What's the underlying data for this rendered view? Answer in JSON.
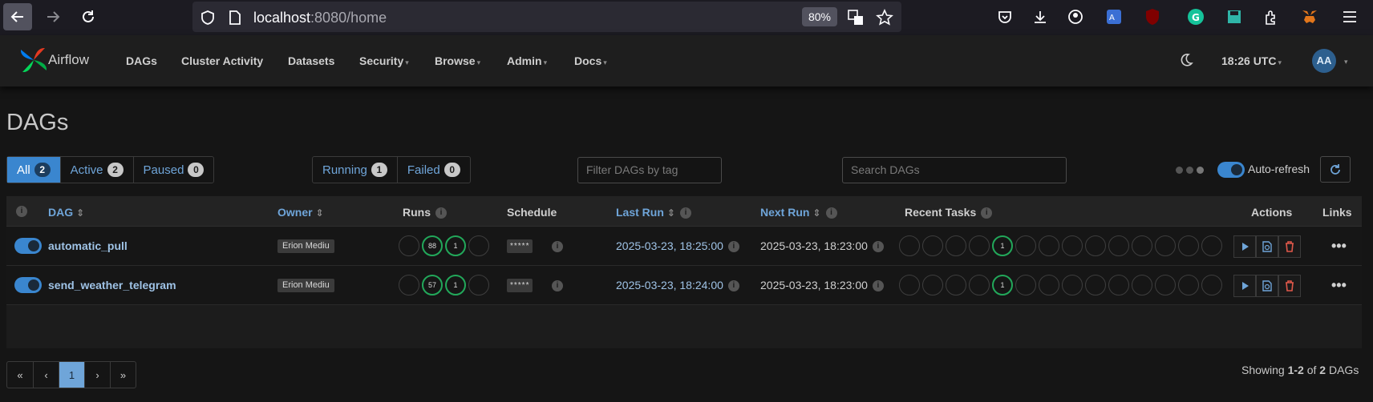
{
  "browser": {
    "url_host": "localhost",
    "url_rest": ":8080/home",
    "zoom": "80%"
  },
  "navbar": {
    "brand": "Airflow",
    "menu": [
      "DAGs",
      "Cluster Activity",
      "Datasets",
      "Security",
      "Browse",
      "Admin",
      "Docs"
    ],
    "time": "18:26 UTC",
    "user_initials": "AA"
  },
  "page": {
    "title": "DAGs",
    "status_filters": [
      {
        "label": "All",
        "count": "2"
      },
      {
        "label": "Active",
        "count": "2"
      },
      {
        "label": "Paused",
        "count": "0"
      }
    ],
    "run_filters": [
      {
        "label": "Running",
        "count": "1"
      },
      {
        "label": "Failed",
        "count": "0"
      }
    ],
    "tag_placeholder": "Filter DAGs by tag",
    "search_placeholder": "Search DAGs",
    "auto_refresh_label": "Auto-refresh"
  },
  "table": {
    "headers": {
      "dag": "DAG",
      "owner": "Owner",
      "runs": "Runs",
      "schedule": "Schedule",
      "last_run": "Last Run",
      "next_run": "Next Run",
      "recent_tasks": "Recent Tasks",
      "actions": "Actions",
      "links": "Links"
    },
    "rows": [
      {
        "name": "automatic_pull",
        "owner": "Erion Mediu",
        "runs": [
          "",
          "88",
          "1",
          ""
        ],
        "schedule": "*****",
        "last_run": "2025-03-23, 18:25:00",
        "next_run": "2025-03-23, 18:23:00",
        "recent_task_success": "1"
      },
      {
        "name": "send_weather_telegram",
        "owner": "Erion Mediu",
        "runs": [
          "",
          "57",
          "1",
          ""
        ],
        "schedule": "*****",
        "last_run": "2025-03-23, 18:24:00",
        "next_run": "2025-03-23, 18:23:00",
        "recent_task_success": "1"
      }
    ]
  },
  "pagination": {
    "first": "«",
    "prev": "‹",
    "current": "1",
    "next": "›",
    "last": "»"
  },
  "footer": {
    "showing_prefix": "Showing",
    "range": "1-2",
    "of": "of",
    "total": "2",
    "suffix": "DAGs"
  },
  "colors": {
    "accent": "#3a86cf",
    "success": "#22a85a",
    "danger": "#e0584a"
  }
}
